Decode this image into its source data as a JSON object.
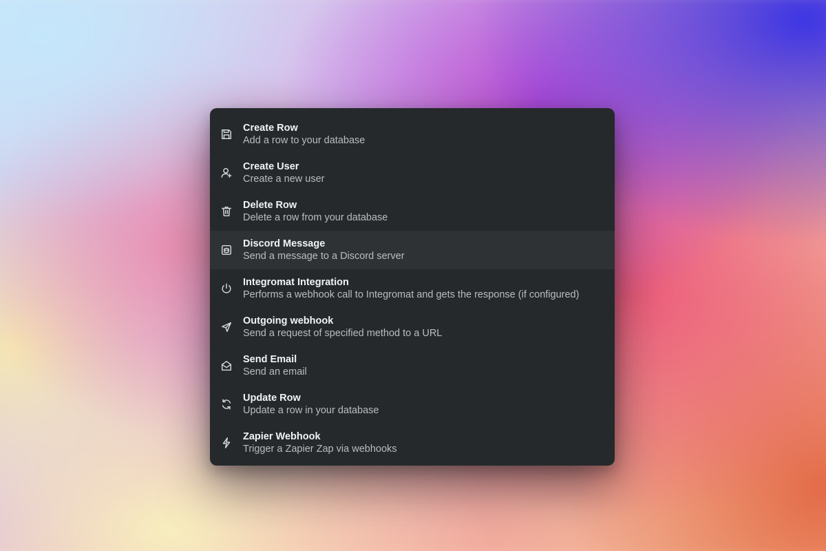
{
  "menu": {
    "items": [
      {
        "title": "Create Row",
        "description": "Add a row to your database",
        "icon": "save-icon"
      },
      {
        "title": "Create User",
        "description": "Create a new user",
        "icon": "user-plus-icon"
      },
      {
        "title": "Delete Row",
        "description": "Delete a row from your database",
        "icon": "trash-icon"
      },
      {
        "title": "Discord Message",
        "description": "Send a message to a Discord server",
        "icon": "discord-icon",
        "active": true
      },
      {
        "title": "Integromat Integration",
        "description": "Performs a webhook call to Integromat and gets the response (if configured)",
        "icon": "power-icon"
      },
      {
        "title": "Outgoing webhook",
        "description": "Send a request of specified method to a URL",
        "icon": "send-icon"
      },
      {
        "title": "Send Email",
        "description": "Send an email",
        "icon": "mail-open-icon"
      },
      {
        "title": "Update Row",
        "description": "Update a row in your database",
        "icon": "refresh-icon"
      },
      {
        "title": "Zapier Webhook",
        "description": "Trigger a Zapier Zap via webhooks",
        "icon": "lightning-icon"
      }
    ]
  },
  "colors": {
    "menu_background": "#25292c",
    "active_item_background": "#2e3235",
    "title_text": "#f2f3f4",
    "description_text": "#b9bdc1"
  }
}
